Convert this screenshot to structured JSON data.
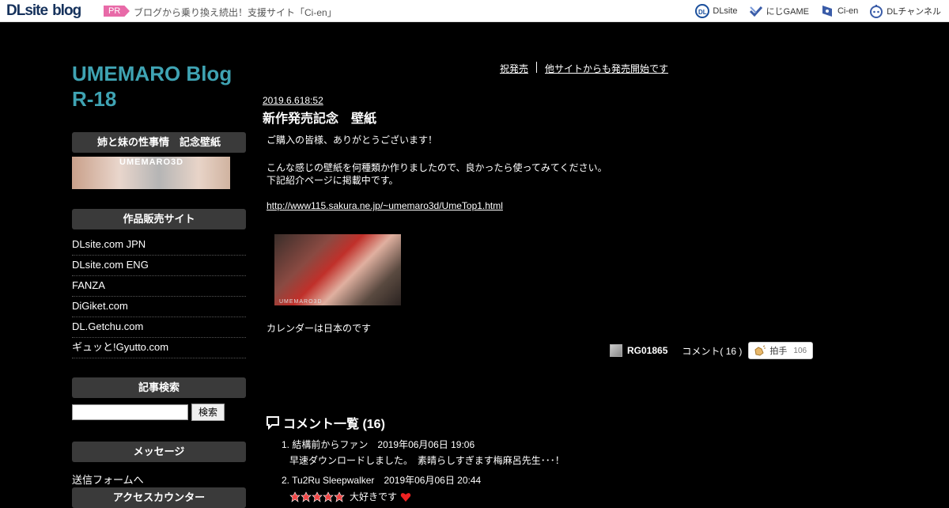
{
  "topbar": {
    "logo_main": "DLsite",
    "logo_sub": "blog",
    "pr_badge": "PR",
    "pr_text": "ブログから乗り換え続出！支援サイト「Ci-en」",
    "links": [
      {
        "label": "DLsite",
        "icon": "dlsite-icon",
        "color": "#1a4f9c"
      },
      {
        "label": "にじGAME",
        "icon": "nijigame-icon",
        "color": "#3a5ca8"
      },
      {
        "label": "Ci-en",
        "icon": "cien-icon",
        "color": "#3a5ca8"
      },
      {
        "label": "DLチャンネル",
        "icon": "dlchannel-icon",
        "color": "#3a5ca8"
      }
    ]
  },
  "sidebar": {
    "blog_title": "UMEMARO Blog R-18",
    "banner_heading": "姉と妹の性事情　記念壁紙",
    "banner_brand": "UMEMARO3D",
    "shops_heading": "作品販売サイト",
    "shops": [
      "DLsite.com JPN",
      "DLsite.com ENG",
      "FANZA",
      "DiGiket.com",
      "DL.Getchu.com",
      "ギュッと!Gyutto.com"
    ],
    "search_heading": "記事検索",
    "search_button": "検索",
    "message_heading": "メッセージ",
    "message_link": "送信フォームへ",
    "counter_heading": "アクセスカウンター"
  },
  "main": {
    "nav_prev": "祝発売",
    "nav_next": "他サイトからも発売開始です",
    "post_date": "2019.6.618:52",
    "post_title": "新作発売記念　壁紙",
    "body_lines": [
      "ご購入の皆様、ありがとうございます！",
      "こんな感じの壁紙を何種類か作りましたので、良かったら使ってみてください。",
      "下記紹介ページに掲載中です。"
    ],
    "post_url": "http://www115.sakura.ne.jp/~umemaro3d/UmeTop1.html",
    "image_watermark": "UMEMARO3D",
    "image_caption": "カレンダーは日本のです",
    "author": "RG01865",
    "comment_count": "コメント( 16 )",
    "clap_label": "拍手",
    "clap_count": "106"
  },
  "comments": {
    "heading": "コメント一覧 (16)",
    "items": [
      {
        "num": "1.",
        "author": "結構前からファン",
        "date": "2019年06月06日 19:06",
        "body": "早速ダウンロードしました。　素晴らしすぎます梅麻呂先生･･･！"
      },
      {
        "num": "2.",
        "author": "Tu2Ru Sleepwalker",
        "date": "2019年06月06日 20:44",
        "body": "大好きです"
      }
    ]
  }
}
